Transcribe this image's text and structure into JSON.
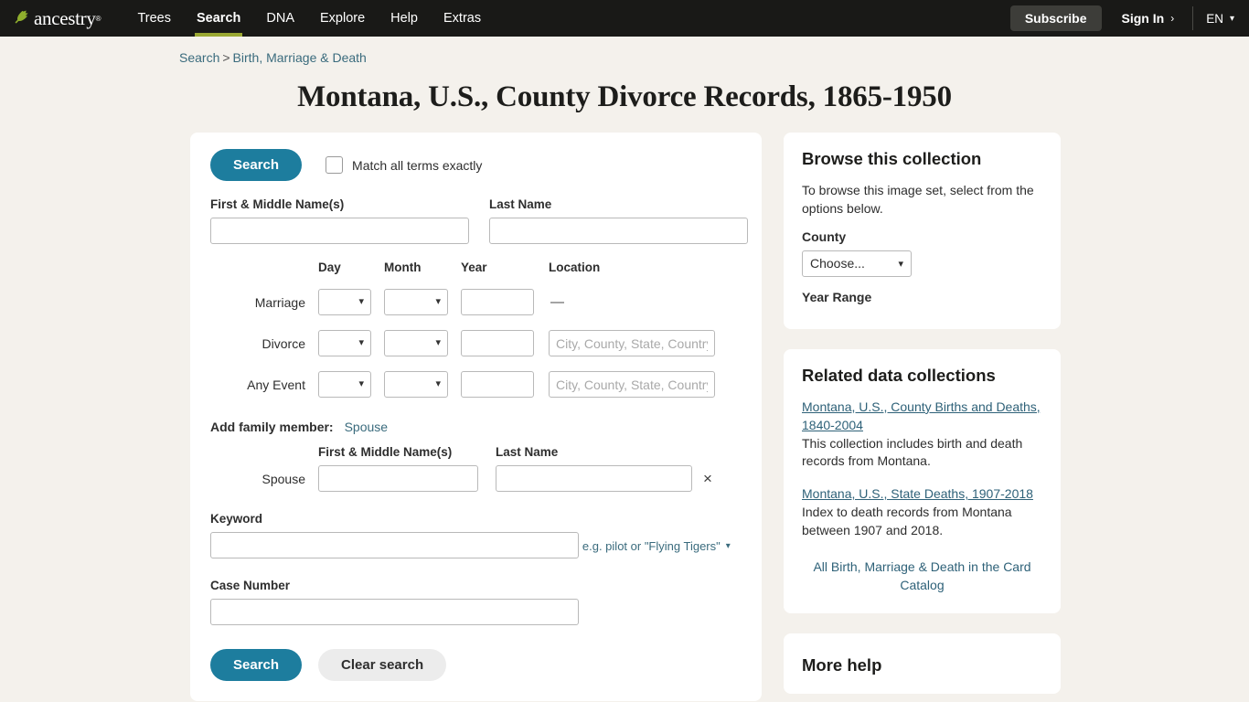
{
  "nav": {
    "logo_text": "ancestry",
    "logo_icon": "leaf-icon",
    "items": [
      {
        "label": "Trees",
        "active": false
      },
      {
        "label": "Search",
        "active": true
      },
      {
        "label": "DNA",
        "active": false
      },
      {
        "label": "Explore",
        "active": false
      },
      {
        "label": "Help",
        "active": false
      },
      {
        "label": "Extras",
        "active": false
      }
    ],
    "subscribe_label": "Subscribe",
    "signin_label": "Sign In",
    "signin_chevron": "›",
    "language": "EN",
    "active_underline_color": "#9aa832",
    "background_color": "#191917"
  },
  "breadcrumb": {
    "root": "Search",
    "separator": ">",
    "current": "Birth, Marriage & Death"
  },
  "page": {
    "title": "Montana, U.S., County Divorce Records, 1865-1950",
    "background_color": "#f4f1ec",
    "accent_color": "#1d7d9e",
    "link_color": "#3a6b7d"
  },
  "search_form": {
    "search_button_top": "Search",
    "match_exactly_label": "Match all terms exactly",
    "match_exactly_checked": false,
    "first_name_label": "First & Middle Name(s)",
    "first_name_value": "",
    "last_name_label": "Last Name",
    "last_name_value": "",
    "column_headers": {
      "day": "Day",
      "month": "Month",
      "year": "Year",
      "location": "Location"
    },
    "events": [
      {
        "label": "Marriage",
        "day": "",
        "month": "",
        "year": "",
        "location_type": "dash",
        "location_dash": "—",
        "location_placeholder": ""
      },
      {
        "label": "Divorce",
        "day": "",
        "month": "",
        "year": "",
        "location_type": "input",
        "location_dash": "",
        "location_placeholder": "City, County, State, Country"
      },
      {
        "label": "Any Event",
        "day": "",
        "month": "",
        "year": "",
        "location_type": "input",
        "location_dash": "",
        "location_placeholder": "City, County, State, Country"
      }
    ],
    "add_family_label": "Add family member:",
    "add_family_link": "Spouse",
    "spouse_first_header": "First & Middle Name(s)",
    "spouse_last_header": "Last Name",
    "spouse_row_label": "Spouse",
    "spouse_first_value": "",
    "spouse_last_value": "",
    "spouse_remove_icon": "×",
    "keyword_label": "Keyword",
    "keyword_value": "",
    "keyword_hint": "e.g. pilot or \"Flying Tigers\"",
    "case_number_label": "Case Number",
    "case_number_value": "",
    "search_button_bottom": "Search",
    "clear_button": "Clear search"
  },
  "sidebar": {
    "browse": {
      "title": "Browse this collection",
      "description": "To browse this image set, select from the options below.",
      "county_label": "County",
      "county_value": "Choose...",
      "year_range_label": "Year Range"
    },
    "related": {
      "title": "Related data collections",
      "items": [
        {
          "link": "Montana, U.S., County Births and Deaths, 1840-2004",
          "description": "This collection includes birth and death records from Montana."
        },
        {
          "link": "Montana, U.S., State Deaths, 1907-2018",
          "description": "Index to death records from Montana between 1907 and 2018."
        }
      ],
      "catalog_link": "All Birth, Marriage & Death in the Card Catalog"
    },
    "more_help": {
      "title": "More help"
    }
  }
}
